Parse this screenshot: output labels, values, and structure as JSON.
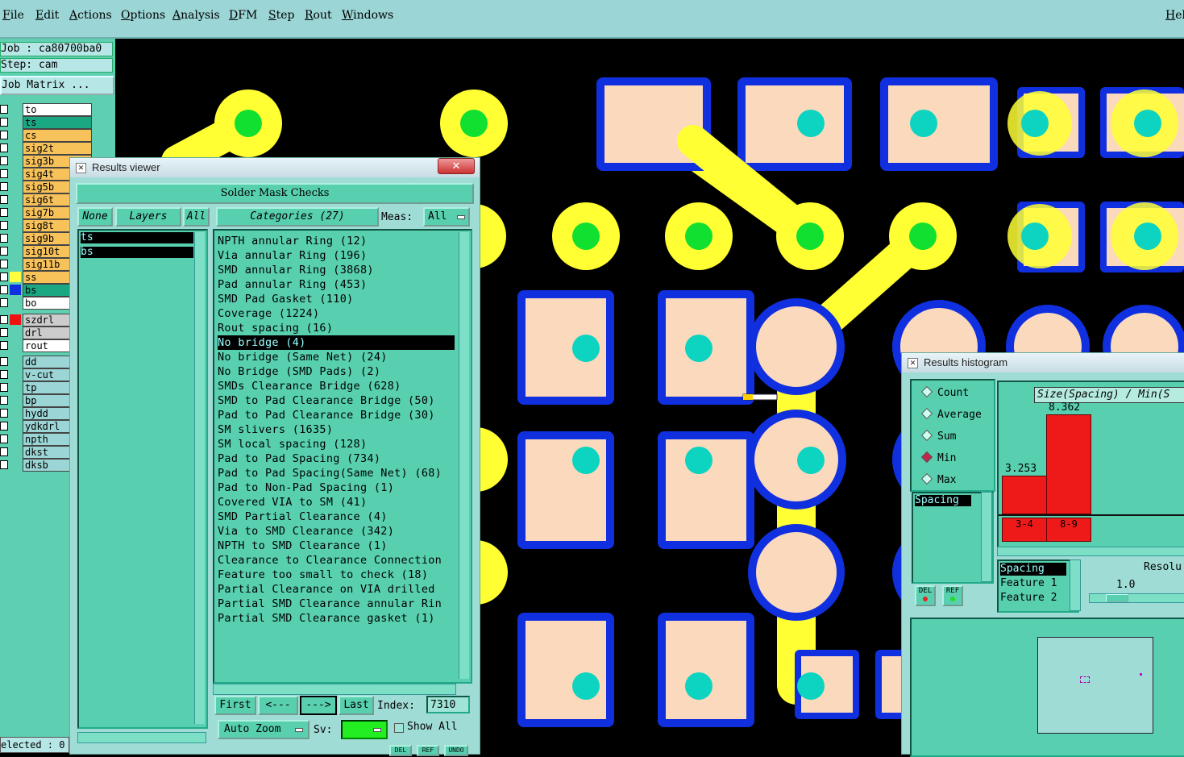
{
  "menubar": {
    "items": [
      "File",
      "Edit",
      "Actions",
      "Options",
      "Analysis",
      "DFM",
      "Step",
      "Rout",
      "Windows"
    ],
    "help": "Hel"
  },
  "left": {
    "job": "Job : ca80700ba0",
    "step": "Step: cam",
    "job_matrix": "Job Matrix ...",
    "selected": "elected : 0",
    "layers": [
      {
        "name": "to",
        "color": "#ffffff",
        "swatch": ""
      },
      {
        "name": "ts",
        "color": "#1aa882",
        "swatch": ""
      },
      {
        "name": "cs",
        "color": "#f7c25a",
        "swatch": ""
      },
      {
        "name": "sig2t",
        "color": "#f7c25a",
        "swatch": ""
      },
      {
        "name": "sig3b",
        "color": "#f7c25a",
        "swatch": ""
      },
      {
        "name": "sig4t",
        "color": "#f7c25a",
        "swatch": ""
      },
      {
        "name": "sig5b",
        "color": "#f7c25a",
        "swatch": ""
      },
      {
        "name": "sig6t",
        "color": "#f7c25a",
        "swatch": ""
      },
      {
        "name": "sig7b",
        "color": "#f7c25a",
        "swatch": ""
      },
      {
        "name": "sig8t",
        "color": "#f7c25a",
        "swatch": ""
      },
      {
        "name": "sig9b",
        "color": "#f7c25a",
        "swatch": ""
      },
      {
        "name": "sig10t",
        "color": "#f7c25a",
        "swatch": ""
      },
      {
        "name": "sig11b",
        "color": "#f7c25a",
        "swatch": ""
      },
      {
        "name": "ss",
        "color": "#f7c25a",
        "swatch": "#ffff40"
      },
      {
        "name": "bs",
        "color": "#1aa882",
        "swatch": "#1030e0"
      },
      {
        "name": "bo",
        "color": "#ffffff",
        "swatch": ""
      },
      {
        "name": "szdrl",
        "color": "#cccccc",
        "swatch": "#ee1111"
      },
      {
        "name": "drl",
        "color": "#cccccc",
        "swatch": ""
      },
      {
        "name": "rout",
        "color": "#ffffff",
        "swatch": ""
      },
      {
        "name": "dd",
        "color": "#9bd5d5",
        "swatch": ""
      },
      {
        "name": "v-cut",
        "color": "#9bd5d5",
        "swatch": ""
      },
      {
        "name": "tp",
        "color": "#9bd5d5",
        "swatch": ""
      },
      {
        "name": "bp",
        "color": "#9bd5d5",
        "swatch": ""
      },
      {
        "name": "hydd",
        "color": "#9bd5d5",
        "swatch": ""
      },
      {
        "name": "ydkdrl",
        "color": "#9bd5d5",
        "swatch": ""
      },
      {
        "name": "npth",
        "color": "#9bd5d5",
        "swatch": ""
      },
      {
        "name": "dkst",
        "color": "#9bd5d5",
        "swatch": ""
      },
      {
        "name": "dksb",
        "color": "#9bd5d5",
        "swatch": ""
      }
    ]
  },
  "results": {
    "window_title": "Results viewer",
    "header": "Solder Mask Checks",
    "none_btn": "None",
    "layers_btn": "Layers",
    "all_btn": "All",
    "categories_btn": "Categories (27)",
    "meas_label": "Meas:",
    "meas_value": "All",
    "layer_list": [
      "ts",
      "bs"
    ],
    "categories": [
      "NPTH annular Ring (12)",
      "Via annular Ring (196)",
      "SMD annular Ring (3868)",
      "Pad annular Ring (453)",
      "SMD Pad Gasket (110)",
      "Coverage (1224)",
      "Rout spacing (16)",
      "No bridge (4)",
      "No bridge (Same Net) (24)",
      "No Bridge (SMD Pads) (2)",
      "SMDs Clearance Bridge (628)",
      "SMD to Pad Clearance Bridge (50)",
      "Pad to Pad Clearance Bridge (30)",
      "SM slivers (1635)",
      "SM local spacing (128)",
      "Pad to Pad Spacing (734)",
      "Pad to Pad Spacing(Same Net) (68)",
      "Pad to Non-Pad Spacing (1)",
      "Covered VIA to SM (41)",
      "SMD Partial Clearance (4)",
      "Via to SMD Clearance (342)",
      "NPTH to SMD Clearance (1)",
      "Clearance to Clearance Connection",
      "Feature too small to check (18)",
      "Partial Clearance on VIA drilled",
      "Partial SMD Clearance annular Rin",
      "Partial SMD Clearance gasket (1)"
    ],
    "selected_index": 7,
    "nav": {
      "first": "First",
      "prev": "<---",
      "next": "--->",
      "last": "Last",
      "index_label": "Index:",
      "index_value": "7310"
    },
    "auto_zoom": "Auto Zoom",
    "sv_label": "Sv:",
    "show_all": "Show All",
    "small_btns": [
      "DEL",
      "REF",
      "UNDO"
    ]
  },
  "histogram": {
    "window_title": "Results histogram",
    "modes": [
      "Count",
      "Average",
      "Sum",
      "Min",
      "Max"
    ],
    "selected_mode": "Min",
    "measure_list": [
      "Spacing"
    ],
    "chart_title": "Size(Spacing) / Min(S",
    "bars": [
      {
        "label": "3.253",
        "bin": "3-4",
        "value": 3.253
      },
      {
        "label": "8.362",
        "bin": "8-9",
        "value": 8.362
      }
    ],
    "fields": [
      "Spacing",
      "Feature 1",
      "Feature 2"
    ],
    "resolution_label": "Resolu",
    "resolution_value": "1.0",
    "del_btn": "DEL",
    "ref_btn": "REF"
  }
}
